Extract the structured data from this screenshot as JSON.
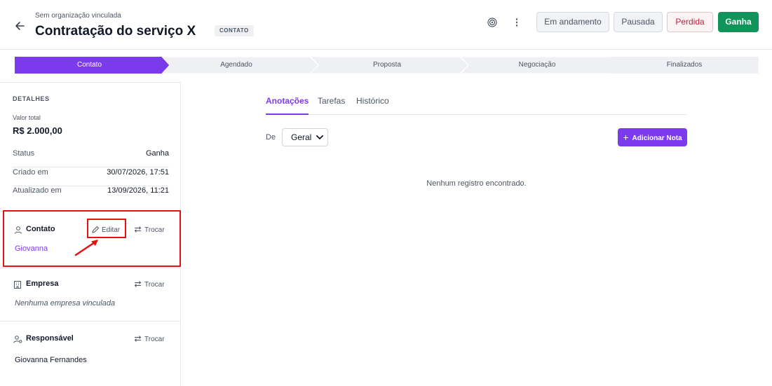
{
  "header": {
    "organization": "Sem organização vinculada",
    "title": "Contratação do serviço X",
    "stage_badge": "CONTATO",
    "buttons": {
      "em_andamento": "Em andamento",
      "pausada": "Pausada",
      "perdida": "Perdida",
      "ganha": "Ganha"
    },
    "icons": [
      "arrow-left-icon",
      "target-icon",
      "more-vertical-icon"
    ]
  },
  "pipeline": {
    "stages": [
      "Contato",
      "Agendado",
      "Proposta",
      "Negociação",
      "Finalizados"
    ],
    "active_index": 0,
    "active_color": "#7c3aed"
  },
  "sidebar": {
    "details_title": "DETALHES",
    "valor_label": "Valor total",
    "valor_value": "R$ 2.000,00",
    "rows": [
      {
        "label": "Status",
        "value": "Ganha"
      },
      {
        "label": "Criado em",
        "value": "30/07/2026, 17:51"
      },
      {
        "label": "Atualizado em",
        "value": "13/09/2026, 11:21"
      }
    ],
    "contato": {
      "title": "Contato",
      "edit_label": "Editar",
      "swap_label": "Trocar",
      "name": "Giovanna"
    },
    "empresa": {
      "title": "Empresa",
      "swap_label": "Trocar",
      "empty": "Nenhuma empresa vinculada"
    },
    "responsavel": {
      "title": "Responsável",
      "swap_label": "Trocar",
      "name": "Giovanna Fernandes"
    }
  },
  "main": {
    "tabs": [
      "Anotações",
      "Tarefas",
      "Histórico"
    ],
    "active_tab": 0,
    "filter_label": "De",
    "filter_value": "Geral",
    "add_note_label": "Adicionar Nota",
    "empty_message": "Nenhum registro encontrado."
  },
  "colors": {
    "accent": "#7c3aed",
    "success": "#11945a",
    "danger": "#c81e3a",
    "annotation": "#e11212"
  }
}
